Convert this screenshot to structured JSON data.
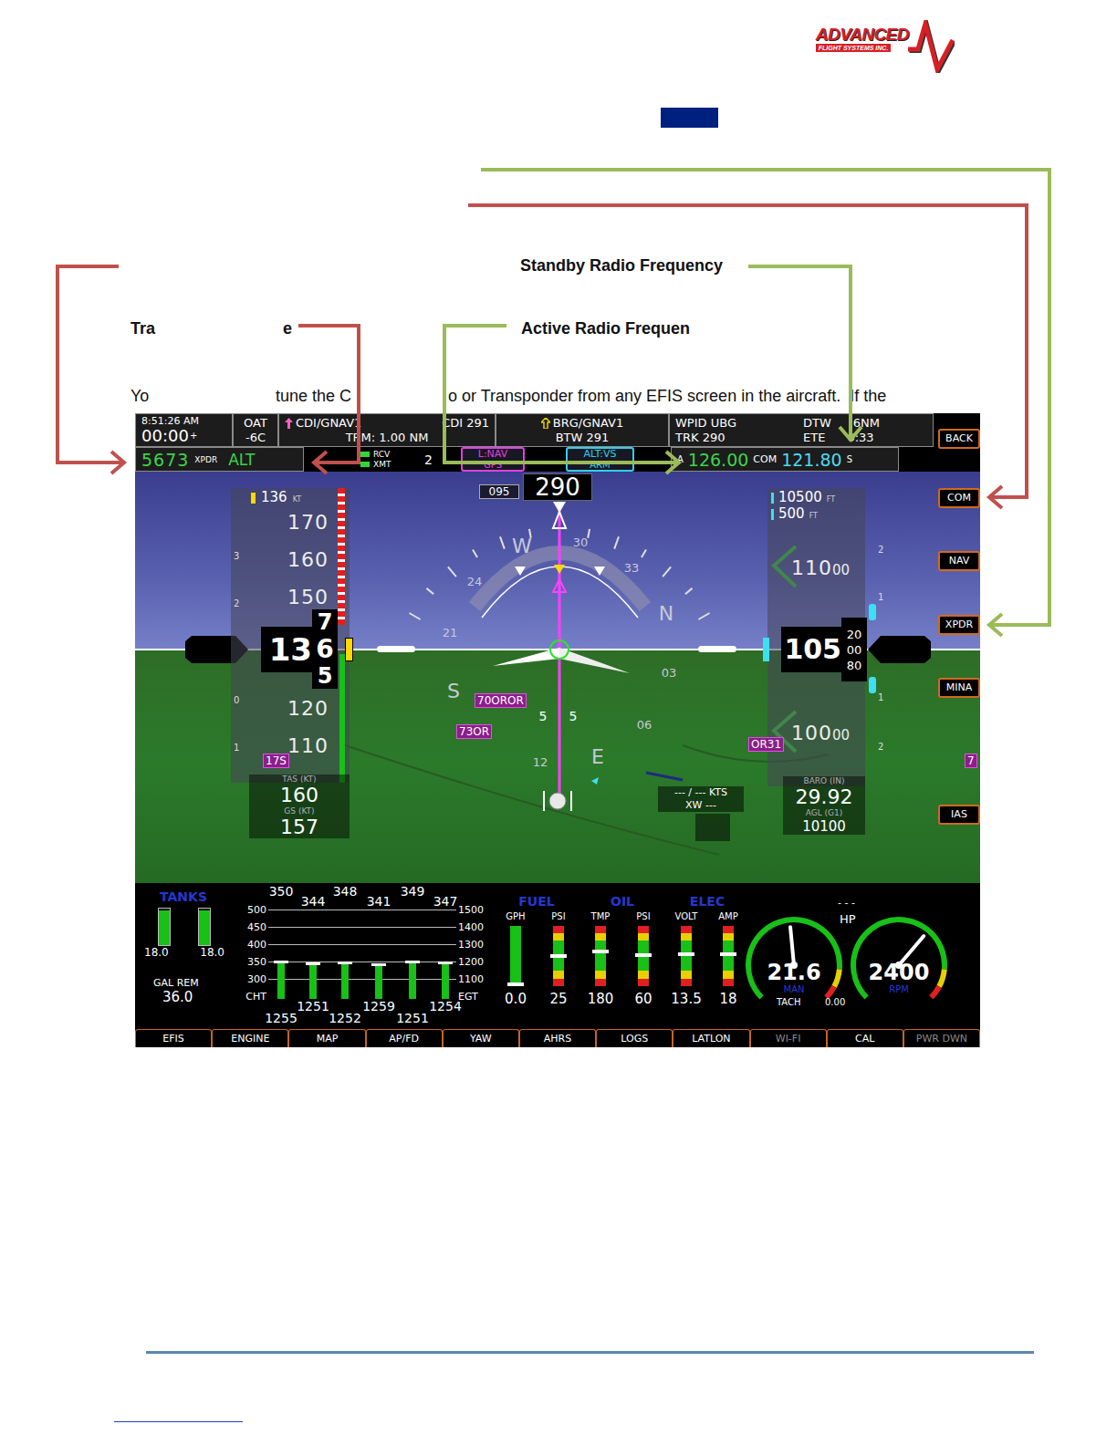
{
  "logo": {
    "name": "ADVANCED",
    "tagline": "FLIGHT SYSTEMS INC."
  },
  "leaders": [
    {
      "color": "#9bbb59"
    },
    {
      "color": "#c0504d"
    },
    {
      "color": "#c0504d"
    },
    {
      "color": "#c0504d"
    },
    {
      "color": "#9bbb59"
    },
    {
      "color": "#9bbb59"
    }
  ],
  "labels": [
    "Standby Radio Frequency",
    "Tra",
    "e",
    "Active Radio Frequen"
  ],
  "body_line": [
    "Yo",
    "tune the C",
    "o or Transponder from any EFIS screen in the aircraft.  If the"
  ],
  "efis": {
    "clock": {
      "time": "8:51:26 AM",
      "timer": "00:00",
      "timer_mark": "+"
    },
    "oat": {
      "label": "OAT",
      "value": "-6C"
    },
    "cdi": {
      "source": "CDI/GNAV1",
      "course": "CDI 291",
      "range": "TRM: 1.00 NM"
    },
    "bearing": {
      "source": "BRG/GNAV1",
      "value": "BTW 291"
    },
    "waypoint": {
      "id": "WPID UBG",
      "track": "TRK 290",
      "distance_label": "DTW",
      "distance": "6NM",
      "ete_label": "ETE",
      "ete": "0:33"
    },
    "transponder": {
      "code": "5673",
      "label": "XPDR",
      "mode": "ALT"
    },
    "datalink": {
      "rcv": "RCV",
      "xmt": "XMT",
      "rcv_on": true,
      "xmt_on": true,
      "channel": "2"
    },
    "modes": [
      {
        "top": "L:NAV",
        "bottom": "GPS",
        "color": "#e040e0"
      },
      {
        "top": "ALT:VS",
        "bottom": "ARM",
        "color": "#30d0e8"
      }
    ],
    "radio": {
      "prefix": "A",
      "active": "126.00",
      "type": "COM",
      "standby": "121.80",
      "suffix": "S"
    },
    "softkeys": [
      "BACK",
      "COM",
      "NAV",
      "XPDR",
      "MINA",
      "IAS"
    ],
    "airspeed": {
      "bug": "136",
      "bug_unit": "KT",
      "scale": [
        "170",
        "160",
        "150",
        "120",
        "110"
      ],
      "readout": "13",
      "roll": [
        "7",
        "6",
        "5"
      ],
      "vsi_marks": [
        "3",
        "2",
        "0",
        "1"
      ],
      "tas_label": "TAS (KT)",
      "tas": "160",
      "gs_label": "GS (KT)",
      "gs": "157"
    },
    "altitude": {
      "bug": "10500",
      "bug_unit": "FT",
      "minimums": "500",
      "minimums_unit": "FT",
      "scale": [
        {
          "big": "110",
          "small": "00"
        },
        {
          "big": "100",
          "small": "00"
        }
      ],
      "readout": "105",
      "roll": [
        "20",
        "00",
        "80"
      ],
      "vsi_marks": [
        "2",
        "1",
        "1",
        "2"
      ],
      "baro_label": "BARO (IN)",
      "baro": "29.92",
      "agl_label": "AGL (G1)",
      "agl": "10100"
    },
    "heading": {
      "bug": "095",
      "value": "290",
      "rose": [
        "W",
        "30",
        "33",
        "24",
        "N",
        "21",
        "S",
        "E",
        "12",
        "06",
        "03"
      ],
      "pitch": [
        "5",
        "5"
      ]
    },
    "tags": [
      "70OROR",
      "73OR",
      "OR31",
      "7",
      "17S"
    ],
    "wind": {
      "speed": "--- / --- KTS",
      "crosswind": "XW ---"
    },
    "engine": {
      "tanks": {
        "title": "TANKS",
        "levels": [
          0.95,
          0.95
        ],
        "values": [
          "18.0",
          "18.0"
        ],
        "label": "GAL REM",
        "total": "36.0"
      },
      "cylinders": {
        "cht_axis": [
          "500",
          "450",
          "400",
          "350",
          "300"
        ],
        "cht_label": "CHT",
        "egt_axis": [
          "1500",
          "1400",
          "1300",
          "1200",
          "1100"
        ],
        "egt_label": "EGT",
        "cht": [
          "350",
          "344",
          "348",
          "341",
          "349",
          "347"
        ],
        "egt": [
          "1255",
          "1251",
          "1252",
          "1259",
          "1251",
          "1254"
        ]
      },
      "groups": [
        {
          "title": "FUEL",
          "gauges": [
            {
              "label": "GPH",
              "value": "0.0",
              "level": 0.03,
              "kind": "plain"
            },
            {
              "label": "PSI",
              "value": "25",
              "level": 0.5,
              "kind": "banded"
            }
          ]
        },
        {
          "title": "OIL",
          "gauges": [
            {
              "label": "TMP",
              "value": "180",
              "level": 0.58,
              "kind": "banded"
            },
            {
              "label": "PSI",
              "value": "60",
              "level": 0.52,
              "kind": "banded"
            }
          ]
        },
        {
          "title": "ELEC",
          "gauges": [
            {
              "label": "VOLT",
              "value": "13.5",
              "level": 0.53,
              "kind": "banded"
            },
            {
              "label": "AMP",
              "value": "18",
              "level": 0.53,
              "kind": "banded"
            }
          ]
        }
      ],
      "dials": [
        {
          "value": "21.6",
          "label": "MAN",
          "level": 0.48
        },
        {
          "value": "2400",
          "label": "RPM",
          "level": 0.65
        }
      ],
      "hp": {
        "label": "HP",
        "value": "- - -"
      },
      "tach": {
        "label": "TACH",
        "value": "0.00"
      }
    },
    "buttons": [
      {
        "label": "EFIS",
        "disabled": false
      },
      {
        "label": "ENGINE",
        "disabled": false
      },
      {
        "label": "MAP",
        "disabled": false
      },
      {
        "label": "AP/FD",
        "disabled": false
      },
      {
        "label": "YAW",
        "disabled": false
      },
      {
        "label": "AHRS",
        "disabled": false
      },
      {
        "label": "LOGS",
        "disabled": false
      },
      {
        "label": "LATLON",
        "disabled": false
      },
      {
        "label": "WI-FI",
        "disabled": true
      },
      {
        "label": "CAL",
        "disabled": false
      },
      {
        "label": "PWR DWN",
        "disabled": true
      }
    ]
  }
}
